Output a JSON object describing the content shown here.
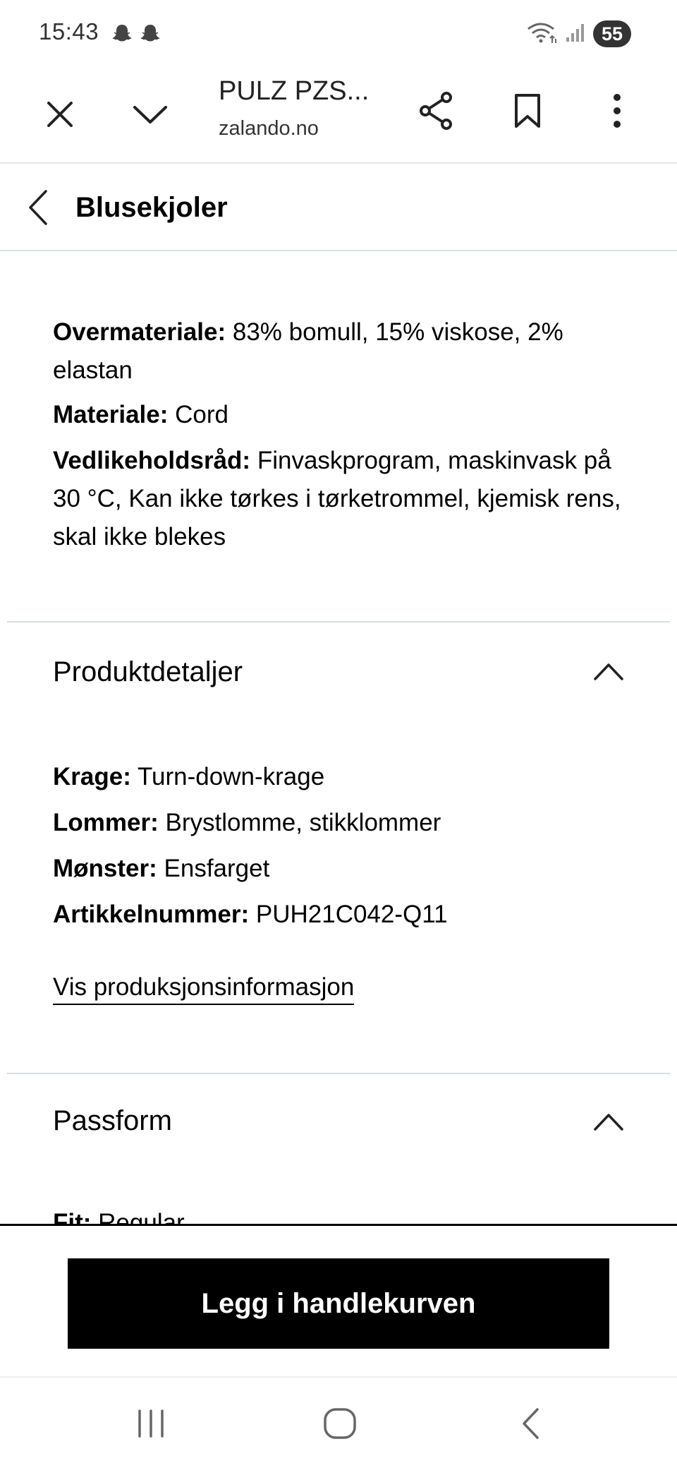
{
  "status_bar": {
    "time": "15:43",
    "notification_icons": [
      "snapchat-icon",
      "snapchat-icon"
    ],
    "battery": "55",
    "wifi_label": "5"
  },
  "browser": {
    "page_title": "PULZ PZS...",
    "domain": "zalando.no",
    "icons": [
      "close-icon",
      "chevron-down-icon",
      "share-icon",
      "bookmark-icon",
      "more-vert-icon"
    ]
  },
  "category": {
    "title": "Blusekjoler"
  },
  "material": {
    "items": [
      {
        "label": "Overmateriale:",
        "value": " 83% bomull, 15% viskose, 2% elastan"
      },
      {
        "label": "Materiale:",
        "value": " Cord"
      },
      {
        "label": "Vedlikeholdsråd:",
        "value": " Finvaskprogram, maskinvask på 30 °C, Kan ikke tørkes i tørketrommel, kjemisk rens, skal ikke blekes"
      }
    ]
  },
  "product_details": {
    "title": "Produktdetaljer",
    "items": [
      {
        "label": "Krage:",
        "value": " Turn-down-krage"
      },
      {
        "label": "Lommer:",
        "value": " Brystlomme, stikklommer"
      },
      {
        "label": "Mønster:",
        "value": " Ensfarget"
      },
      {
        "label": "Artikkelnummer:",
        "value": " PUH21C042-Q11"
      }
    ],
    "link": "Vis produksjonsinformasjon"
  },
  "fit": {
    "title": "Passform",
    "items": [
      {
        "label": "Fit:",
        "value": " Regular"
      }
    ]
  },
  "cta": {
    "label": "Legg i handlekurven"
  },
  "nav": {
    "icons": [
      "recent-apps-icon",
      "home-icon",
      "back-icon"
    ]
  }
}
